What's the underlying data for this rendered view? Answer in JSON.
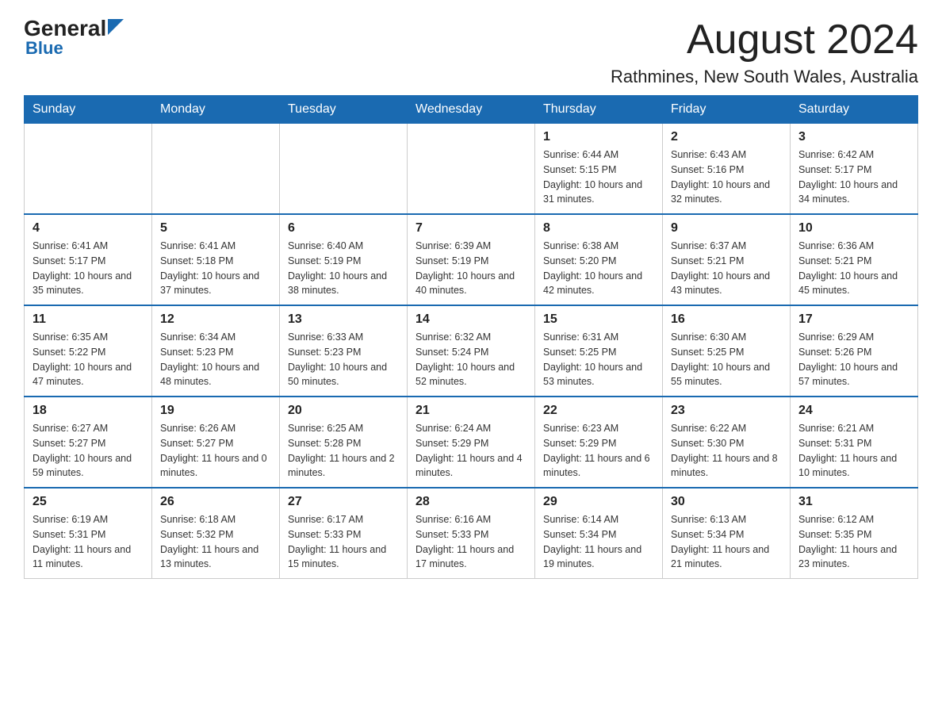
{
  "header": {
    "logo_general": "General",
    "logo_blue": "Blue",
    "title": "August 2024",
    "subtitle": "Rathmines, New South Wales, Australia"
  },
  "weekdays": [
    "Sunday",
    "Monday",
    "Tuesday",
    "Wednesday",
    "Thursday",
    "Friday",
    "Saturday"
  ],
  "weeks": [
    {
      "days": [
        {
          "num": "",
          "info": ""
        },
        {
          "num": "",
          "info": ""
        },
        {
          "num": "",
          "info": ""
        },
        {
          "num": "",
          "info": ""
        },
        {
          "num": "1",
          "info": "Sunrise: 6:44 AM\nSunset: 5:15 PM\nDaylight: 10 hours and 31 minutes."
        },
        {
          "num": "2",
          "info": "Sunrise: 6:43 AM\nSunset: 5:16 PM\nDaylight: 10 hours and 32 minutes."
        },
        {
          "num": "3",
          "info": "Sunrise: 6:42 AM\nSunset: 5:17 PM\nDaylight: 10 hours and 34 minutes."
        }
      ]
    },
    {
      "days": [
        {
          "num": "4",
          "info": "Sunrise: 6:41 AM\nSunset: 5:17 PM\nDaylight: 10 hours and 35 minutes."
        },
        {
          "num": "5",
          "info": "Sunrise: 6:41 AM\nSunset: 5:18 PM\nDaylight: 10 hours and 37 minutes."
        },
        {
          "num": "6",
          "info": "Sunrise: 6:40 AM\nSunset: 5:19 PM\nDaylight: 10 hours and 38 minutes."
        },
        {
          "num": "7",
          "info": "Sunrise: 6:39 AM\nSunset: 5:19 PM\nDaylight: 10 hours and 40 minutes."
        },
        {
          "num": "8",
          "info": "Sunrise: 6:38 AM\nSunset: 5:20 PM\nDaylight: 10 hours and 42 minutes."
        },
        {
          "num": "9",
          "info": "Sunrise: 6:37 AM\nSunset: 5:21 PM\nDaylight: 10 hours and 43 minutes."
        },
        {
          "num": "10",
          "info": "Sunrise: 6:36 AM\nSunset: 5:21 PM\nDaylight: 10 hours and 45 minutes."
        }
      ]
    },
    {
      "days": [
        {
          "num": "11",
          "info": "Sunrise: 6:35 AM\nSunset: 5:22 PM\nDaylight: 10 hours and 47 minutes."
        },
        {
          "num": "12",
          "info": "Sunrise: 6:34 AM\nSunset: 5:23 PM\nDaylight: 10 hours and 48 minutes."
        },
        {
          "num": "13",
          "info": "Sunrise: 6:33 AM\nSunset: 5:23 PM\nDaylight: 10 hours and 50 minutes."
        },
        {
          "num": "14",
          "info": "Sunrise: 6:32 AM\nSunset: 5:24 PM\nDaylight: 10 hours and 52 minutes."
        },
        {
          "num": "15",
          "info": "Sunrise: 6:31 AM\nSunset: 5:25 PM\nDaylight: 10 hours and 53 minutes."
        },
        {
          "num": "16",
          "info": "Sunrise: 6:30 AM\nSunset: 5:25 PM\nDaylight: 10 hours and 55 minutes."
        },
        {
          "num": "17",
          "info": "Sunrise: 6:29 AM\nSunset: 5:26 PM\nDaylight: 10 hours and 57 minutes."
        }
      ]
    },
    {
      "days": [
        {
          "num": "18",
          "info": "Sunrise: 6:27 AM\nSunset: 5:27 PM\nDaylight: 10 hours and 59 minutes."
        },
        {
          "num": "19",
          "info": "Sunrise: 6:26 AM\nSunset: 5:27 PM\nDaylight: 11 hours and 0 minutes."
        },
        {
          "num": "20",
          "info": "Sunrise: 6:25 AM\nSunset: 5:28 PM\nDaylight: 11 hours and 2 minutes."
        },
        {
          "num": "21",
          "info": "Sunrise: 6:24 AM\nSunset: 5:29 PM\nDaylight: 11 hours and 4 minutes."
        },
        {
          "num": "22",
          "info": "Sunrise: 6:23 AM\nSunset: 5:29 PM\nDaylight: 11 hours and 6 minutes."
        },
        {
          "num": "23",
          "info": "Sunrise: 6:22 AM\nSunset: 5:30 PM\nDaylight: 11 hours and 8 minutes."
        },
        {
          "num": "24",
          "info": "Sunrise: 6:21 AM\nSunset: 5:31 PM\nDaylight: 11 hours and 10 minutes."
        }
      ]
    },
    {
      "days": [
        {
          "num": "25",
          "info": "Sunrise: 6:19 AM\nSunset: 5:31 PM\nDaylight: 11 hours and 11 minutes."
        },
        {
          "num": "26",
          "info": "Sunrise: 6:18 AM\nSunset: 5:32 PM\nDaylight: 11 hours and 13 minutes."
        },
        {
          "num": "27",
          "info": "Sunrise: 6:17 AM\nSunset: 5:33 PM\nDaylight: 11 hours and 15 minutes."
        },
        {
          "num": "28",
          "info": "Sunrise: 6:16 AM\nSunset: 5:33 PM\nDaylight: 11 hours and 17 minutes."
        },
        {
          "num": "29",
          "info": "Sunrise: 6:14 AM\nSunset: 5:34 PM\nDaylight: 11 hours and 19 minutes."
        },
        {
          "num": "30",
          "info": "Sunrise: 6:13 AM\nSunset: 5:34 PM\nDaylight: 11 hours and 21 minutes."
        },
        {
          "num": "31",
          "info": "Sunrise: 6:12 AM\nSunset: 5:35 PM\nDaylight: 11 hours and 23 minutes."
        }
      ]
    }
  ]
}
